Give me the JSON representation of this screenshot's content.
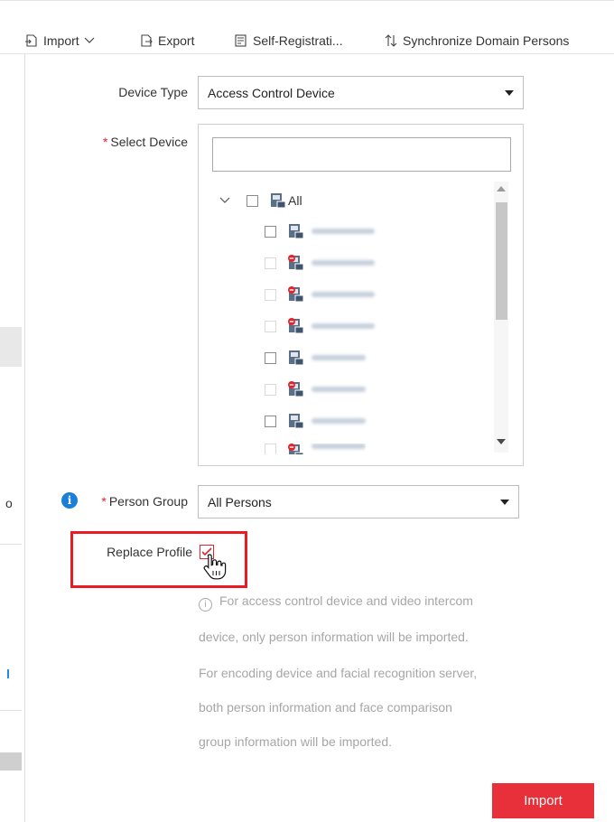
{
  "toolbar": {
    "import_label": "Import",
    "export_label": "Export",
    "self_registration_label": "Self-Registrati...",
    "synchronize_label": "Synchronize Domain Persons"
  },
  "left_fragment": "o",
  "form": {
    "device_type": {
      "label": "Device Type",
      "value": "Access Control Device"
    },
    "select_device": {
      "required_mark": "*",
      "label": "Select Device",
      "search_value": "",
      "tree_root_label": "All",
      "devices": [
        {
          "status": "online",
          "enabled": true
        },
        {
          "status": "offline",
          "enabled": false
        },
        {
          "status": "offline",
          "enabled": false
        },
        {
          "status": "offline",
          "enabled": false
        },
        {
          "status": "online",
          "enabled": true
        },
        {
          "status": "offline",
          "enabled": false
        },
        {
          "status": "online",
          "enabled": true
        },
        {
          "status": "offline",
          "enabled": false
        }
      ]
    },
    "person_group": {
      "required_mark": "*",
      "label": "Person Group",
      "value": "All Persons"
    },
    "replace_profile": {
      "label": "Replace Profile",
      "checked": true
    }
  },
  "hint": {
    "icon": "info-icon",
    "lines": [
      "For access control device and video intercom",
      "device, only person information will be imported.",
      "For encoding device and facial recognition server,",
      "both person information and face comparison",
      "group information will be imported."
    ]
  },
  "import_button_label": "Import",
  "colors": {
    "accent": "#e8303a",
    "highlight": "#e81c22",
    "info": "#1b7fd6"
  }
}
